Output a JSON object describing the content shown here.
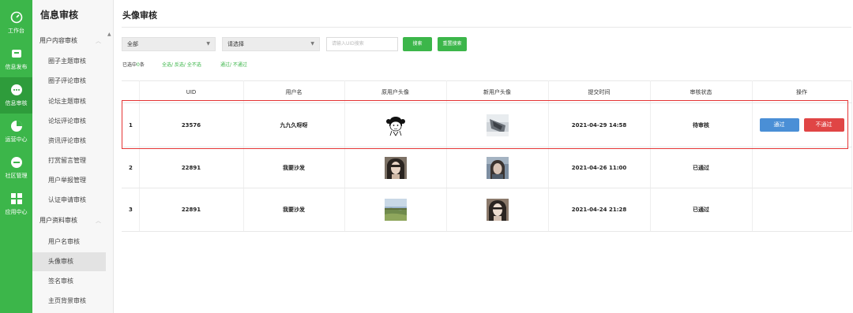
{
  "rail": [
    {
      "label": "工作台",
      "icon": "dashboard-icon"
    },
    {
      "label": "信息发布",
      "icon": "publish-icon"
    },
    {
      "label": "信息审核",
      "icon": "chat-icon",
      "active": true
    },
    {
      "label": "运营中心",
      "icon": "operations-icon"
    },
    {
      "label": "社区管理",
      "icon": "community-icon"
    },
    {
      "label": "应用中心",
      "icon": "apps-icon"
    }
  ],
  "sidebar": {
    "title": "信息审核",
    "group1": "用户内容审核",
    "group1_items": [
      "圈子主题审核",
      "圈子评论审核",
      "论坛主题审核",
      "论坛评论审核",
      "资讯评论审核",
      "打赏留言管理",
      "用户举报管理",
      "认证申请审核"
    ],
    "group2": "用户资料审核",
    "group2_items": [
      "用户名审核",
      "头像审核",
      "签名审核",
      "主页背景审核"
    ]
  },
  "page": {
    "title": "头像审核",
    "filter_all": "全部",
    "filter_select": "请选择",
    "search_placeholder": "请输入UID搜索",
    "search_btn": "搜索",
    "reset_btn": "重置搜索",
    "selected_prefix": "已选中",
    "selected_count": "0",
    "selected_suffix": "条",
    "select_links": "全选/ 反选/ 全不选",
    "approve_links": "通过/ 不通过"
  },
  "table": {
    "headers": [
      "",
      "UID",
      "用户名",
      "原用户头像",
      "新用户头像",
      "提交时间",
      "审核状态",
      "操作"
    ],
    "rows": [
      {
        "idx": "1",
        "uid": "23576",
        "name": "九九久呀呀",
        "time": "2021-04-29 14:58",
        "status": "待审核",
        "pending": true
      },
      {
        "idx": "2",
        "uid": "22891",
        "name": "我要沙发",
        "time": "2021-04-26 11:00",
        "status": "已通过",
        "pending": false
      },
      {
        "idx": "3",
        "uid": "22891",
        "name": "我要沙发",
        "time": "2021-04-24 21:28",
        "status": "已通过",
        "pending": false
      }
    ],
    "approve_label": "通过",
    "reject_label": "不通过"
  },
  "colors": {
    "brand": "#3cb64a",
    "primary": "#4a8fd6",
    "danger": "#e04545",
    "highlight": "#e53535"
  }
}
